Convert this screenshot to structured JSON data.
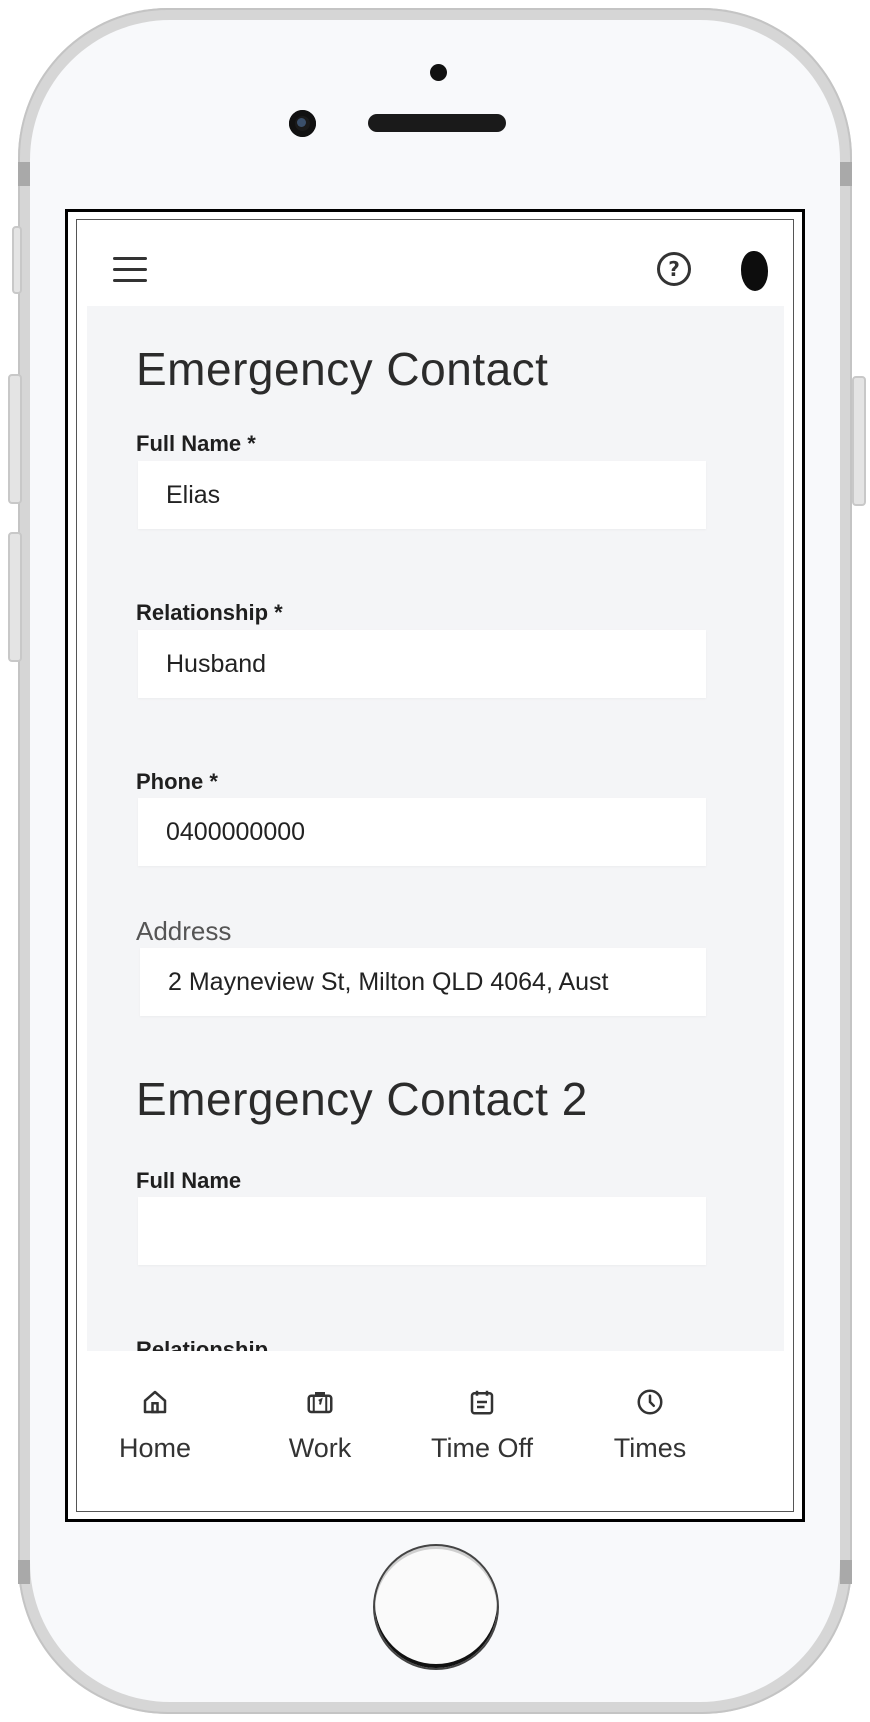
{
  "header": {
    "help_label": "?"
  },
  "section1": {
    "title": "Emergency Contact",
    "fields": [
      {
        "label": "Full Name *",
        "value": "Elias"
      },
      {
        "label": "Relationship *",
        "value": "Husband"
      },
      {
        "label": "Phone *",
        "value": "0400000000"
      },
      {
        "label": "Address",
        "value": "2 Mayneview St, Milton QLD 4064, Aust"
      }
    ]
  },
  "section2": {
    "title": "Emergency Contact 2",
    "fields": [
      {
        "label": "Full Name",
        "value": ""
      },
      {
        "label": "Relationship",
        "value": ""
      }
    ]
  },
  "bottom_nav": {
    "items": [
      {
        "label": "Home",
        "icon": "home-icon"
      },
      {
        "label": "Work",
        "icon": "briefcase-icon"
      },
      {
        "label": "Time Off",
        "icon": "calendar-icon"
      },
      {
        "label": "Times",
        "icon": "clock-icon"
      }
    ]
  }
}
